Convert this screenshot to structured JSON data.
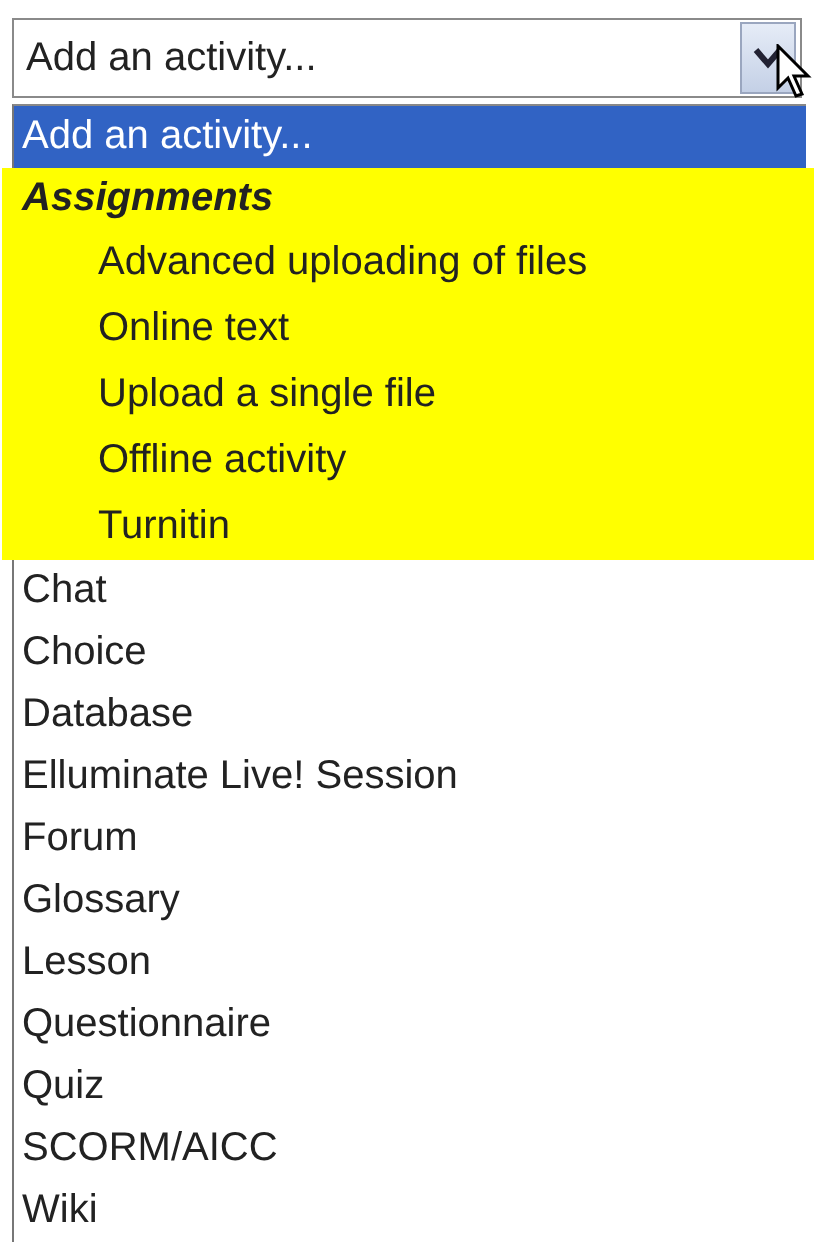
{
  "select": {
    "value": "Add an activity..."
  },
  "options": [
    {
      "kind": "option",
      "label": "Add an activity...",
      "selected": true
    },
    {
      "kind": "group",
      "label": "Assignments",
      "highlighted": true,
      "children": [
        {
          "label": "Advanced uploading of files",
          "selected": false
        },
        {
          "label": "Online text",
          "selected": false
        },
        {
          "label": "Upload a single file",
          "selected": false
        },
        {
          "label": "Offline activity",
          "selected": false
        },
        {
          "label": "Turnitin",
          "selected": false
        }
      ]
    },
    {
      "kind": "option",
      "label": "Chat",
      "selected": false
    },
    {
      "kind": "option",
      "label": "Choice",
      "selected": false
    },
    {
      "kind": "option",
      "label": "Database",
      "selected": false
    },
    {
      "kind": "option",
      "label": "Elluminate Live! Session",
      "selected": false
    },
    {
      "kind": "option",
      "label": "Forum",
      "selected": false
    },
    {
      "kind": "option",
      "label": "Glossary",
      "selected": false
    },
    {
      "kind": "option",
      "label": "Lesson",
      "selected": false
    },
    {
      "kind": "option",
      "label": "Questionnaire",
      "selected": false
    },
    {
      "kind": "option",
      "label": "Quiz",
      "selected": false
    },
    {
      "kind": "option",
      "label": "SCORM/AICC",
      "selected": false
    },
    {
      "kind": "option",
      "label": "Wiki",
      "selected": false
    }
  ]
}
